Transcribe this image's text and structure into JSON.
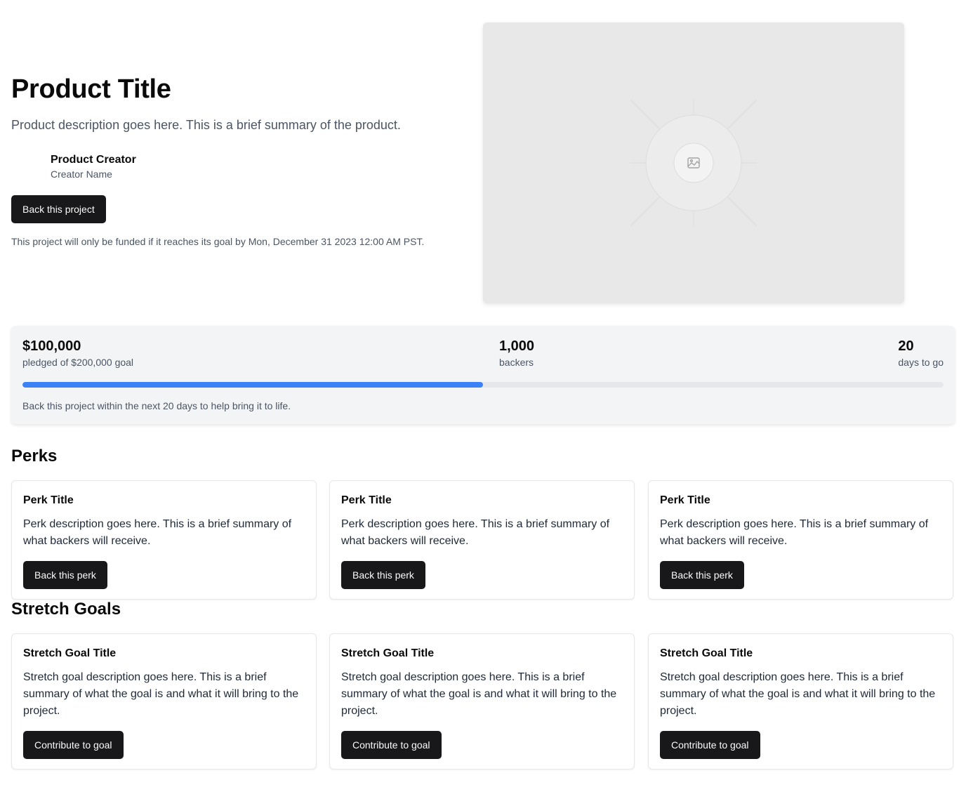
{
  "product": {
    "title": "Product Title",
    "description": "Product description goes here. This is a brief summary of the product.",
    "creator_label": "Product Creator",
    "creator_name": "Creator Name",
    "back_button": "Back this project",
    "funding_note": "This project will only be funded if it reaches its goal by Mon, December 31 2023 12:00 AM PST."
  },
  "media": {
    "icon": "image-placeholder-icon"
  },
  "stats": {
    "pledged": "$100,000",
    "pledged_label": "pledged of $200,000 goal",
    "backers": "1,000",
    "backers_label": "backers",
    "days": "20",
    "days_label": "days to go",
    "progress_fraction": 0.5,
    "note": "Back this project within the next 20 days to help bring it to life."
  },
  "perks": {
    "heading": "Perks",
    "items": [
      {
        "title": "Perk Title",
        "description": "Perk description goes here. This is a brief summary of what backers will receive.",
        "button": "Back this perk"
      },
      {
        "title": "Perk Title",
        "description": "Perk description goes here. This is a brief summary of what backers will receive.",
        "button": "Back this perk"
      },
      {
        "title": "Perk Title",
        "description": "Perk description goes here. This is a brief summary of what backers will receive.",
        "button": "Back this perk"
      }
    ]
  },
  "stretch_goals": {
    "heading": "Stretch Goals",
    "items": [
      {
        "title": "Stretch Goal Title",
        "description": "Stretch goal description goes here. This is a brief summary of what the goal is and what it will bring to the project.",
        "button": "Contribute to goal"
      },
      {
        "title": "Stretch Goal Title",
        "description": "Stretch goal description goes here. This is a brief summary of what the goal is and what it will bring to the project.",
        "button": "Contribute to goal"
      },
      {
        "title": "Stretch Goal Title",
        "description": "Stretch goal description goes here. This is a brief summary of what the goal is and what it will bring to the project.",
        "button": "Contribute to goal"
      }
    ]
  },
  "colors": {
    "primary_button": "#18181b",
    "progress": "#3b82f6",
    "muted_text": "#4b5563"
  }
}
